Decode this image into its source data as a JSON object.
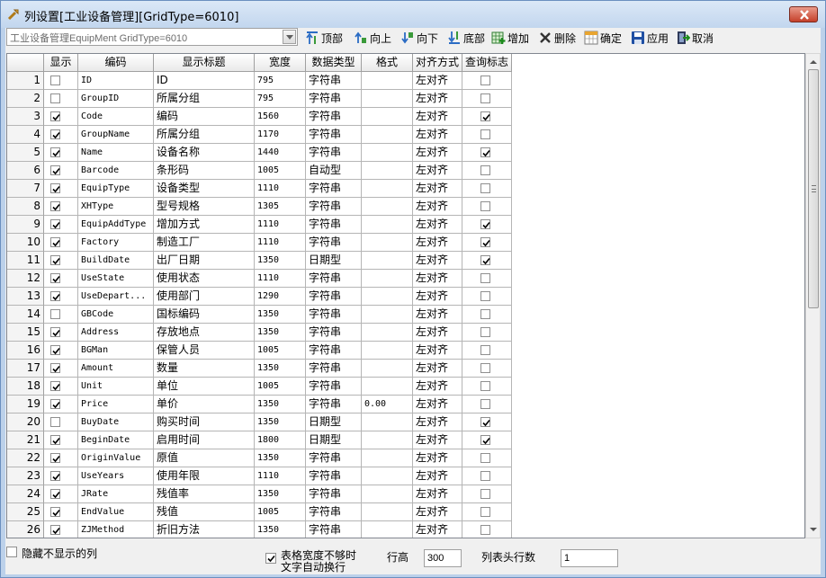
{
  "window": {
    "title": "列设置[工业设备管理][GridType=6010]"
  },
  "combo": {
    "value": "工业设备管理EquipMent GridType=6010"
  },
  "toolbar": {
    "top": "顶部",
    "up": "向上",
    "down": "向下",
    "bottom": "底部",
    "add": "增加",
    "delete": "删除",
    "ok": "确定",
    "apply": "应用",
    "cancel": "取消"
  },
  "grid": {
    "headers": [
      "显示",
      "编码",
      "显示标题",
      "宽度",
      "数据类型",
      "格式",
      "对齐方式",
      "查询标志"
    ],
    "rows": [
      {
        "n": "1",
        "show": false,
        "code": "ID",
        "title": "ID",
        "width": "795",
        "type": "字符串",
        "fmt": "",
        "align": "左对齐",
        "query": false
      },
      {
        "n": "2",
        "show": false,
        "code": "GroupID",
        "title": "所属分组",
        "width": "795",
        "type": "字符串",
        "fmt": "",
        "align": "左对齐",
        "query": false
      },
      {
        "n": "3",
        "show": true,
        "code": "Code",
        "title": "编码",
        "width": "1560",
        "type": "字符串",
        "fmt": "",
        "align": "左对齐",
        "query": true
      },
      {
        "n": "4",
        "show": true,
        "code": "GroupName",
        "title": "所属分组",
        "width": "1170",
        "type": "字符串",
        "fmt": "",
        "align": "左对齐",
        "query": false
      },
      {
        "n": "5",
        "show": true,
        "code": "Name",
        "title": "设备名称",
        "width": "1440",
        "type": "字符串",
        "fmt": "",
        "align": "左对齐",
        "query": true
      },
      {
        "n": "6",
        "show": true,
        "code": "Barcode",
        "title": "条形码",
        "width": "1005",
        "type": "自动型",
        "fmt": "",
        "align": "左对齐",
        "query": false
      },
      {
        "n": "7",
        "show": true,
        "code": "EquipType",
        "title": "设备类型",
        "width": "1110",
        "type": "字符串",
        "fmt": "",
        "align": "左对齐",
        "query": false
      },
      {
        "n": "8",
        "show": true,
        "code": "XHType",
        "title": "型号规格",
        "width": "1305",
        "type": "字符串",
        "fmt": "",
        "align": "左对齐",
        "query": false
      },
      {
        "n": "9",
        "show": true,
        "code": "EquipAddType",
        "title": "增加方式",
        "width": "1110",
        "type": "字符串",
        "fmt": "",
        "align": "左对齐",
        "query": true
      },
      {
        "n": "10",
        "show": true,
        "code": "Factory",
        "title": "制造工厂",
        "width": "1110",
        "type": "字符串",
        "fmt": "",
        "align": "左对齐",
        "query": true
      },
      {
        "n": "11",
        "show": true,
        "code": "BuildDate",
        "title": "出厂日期",
        "width": "1350",
        "type": "日期型",
        "fmt": "",
        "align": "左对齐",
        "query": true
      },
      {
        "n": "12",
        "show": true,
        "code": "UseState",
        "title": "使用状态",
        "width": "1110",
        "type": "字符串",
        "fmt": "",
        "align": "左对齐",
        "query": false
      },
      {
        "n": "13",
        "show": true,
        "code": "UseDepart...",
        "title": "使用部门",
        "width": "1290",
        "type": "字符串",
        "fmt": "",
        "align": "左对齐",
        "query": false
      },
      {
        "n": "14",
        "show": false,
        "code": "GBCode",
        "title": "国标编码",
        "width": "1350",
        "type": "字符串",
        "fmt": "",
        "align": "左对齐",
        "query": false
      },
      {
        "n": "15",
        "show": true,
        "code": "Address",
        "title": "存放地点",
        "width": "1350",
        "type": "字符串",
        "fmt": "",
        "align": "左对齐",
        "query": false
      },
      {
        "n": "16",
        "show": true,
        "code": "BGMan",
        "title": "保管人员",
        "width": "1005",
        "type": "字符串",
        "fmt": "",
        "align": "左对齐",
        "query": false
      },
      {
        "n": "17",
        "show": true,
        "code": "Amount",
        "title": "数量",
        "width": "1350",
        "type": "字符串",
        "fmt": "",
        "align": "左对齐",
        "query": false
      },
      {
        "n": "18",
        "show": true,
        "code": "Unit",
        "title": "单位",
        "width": "1005",
        "type": "字符串",
        "fmt": "",
        "align": "左对齐",
        "query": false
      },
      {
        "n": "19",
        "show": true,
        "code": "Price",
        "title": "单价",
        "width": "1350",
        "type": "字符串",
        "fmt": "0.00",
        "align": "左对齐",
        "query": false
      },
      {
        "n": "20",
        "show": false,
        "code": "BuyDate",
        "title": "购买时间",
        "width": "1350",
        "type": "日期型",
        "fmt": "",
        "align": "左对齐",
        "query": true
      },
      {
        "n": "21",
        "show": true,
        "code": "BeginDate",
        "title": "启用时间",
        "width": "1800",
        "type": "日期型",
        "fmt": "",
        "align": "左对齐",
        "query": true
      },
      {
        "n": "22",
        "show": true,
        "code": "OriginValue",
        "title": "原值",
        "width": "1350",
        "type": "字符串",
        "fmt": "",
        "align": "左对齐",
        "query": false
      },
      {
        "n": "23",
        "show": true,
        "code": "UseYears",
        "title": "使用年限",
        "width": "1110",
        "type": "字符串",
        "fmt": "",
        "align": "左对齐",
        "query": false
      },
      {
        "n": "24",
        "show": true,
        "code": "JRate",
        "title": "残值率",
        "width": "1350",
        "type": "字符串",
        "fmt": "",
        "align": "左对齐",
        "query": false
      },
      {
        "n": "25",
        "show": true,
        "code": "EndValue",
        "title": "残值",
        "width": "1005",
        "type": "字符串",
        "fmt": "",
        "align": "左对齐",
        "query": false
      },
      {
        "n": "26",
        "show": true,
        "code": "ZJMethod",
        "title": "折旧方法",
        "width": "1350",
        "type": "字符串",
        "fmt": "",
        "align": "左对齐",
        "query": false
      }
    ]
  },
  "footer": {
    "hide_label": "隐藏不显示的列",
    "hide_checked": false,
    "wrap_label_1": "表格宽度不够时",
    "wrap_label_2": "文字自动换行",
    "wrap_checked": true,
    "row_height_label": "行高",
    "row_height_value": "300",
    "header_rows_label": "列表头行数",
    "header_rows_value": "1"
  }
}
